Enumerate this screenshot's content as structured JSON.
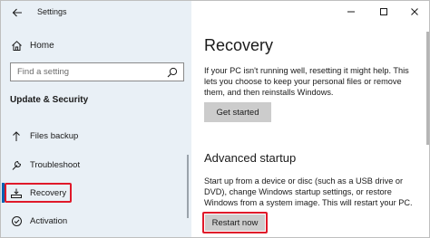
{
  "window": {
    "title": "Settings"
  },
  "sidebar": {
    "home_label": "Home",
    "search_placeholder": "Find a setting",
    "section_title": "Update & Security",
    "items": [
      {
        "label": "Files backup",
        "icon": "upload-arrow-icon",
        "selected": false
      },
      {
        "label": "Troubleshoot",
        "icon": "wrench-icon",
        "selected": false
      },
      {
        "label": "Recovery",
        "icon": "recovery-icon",
        "selected": true
      },
      {
        "label": "Activation",
        "icon": "check-circle-icon",
        "selected": false
      }
    ]
  },
  "content": {
    "title": "Recovery",
    "reset_description": "If your PC isn't running well, resetting it might help. This lets you choose to keep your personal files or remove them, and then reinstalls Windows.",
    "get_started_label": "Get started",
    "advanced_title": "Advanced startup",
    "advanced_description": "Start up from a device or disc (such as a USB drive or DVD), change Windows startup settings, or restore Windows from a system image. This will restart your PC.",
    "restart_label": "Restart now"
  },
  "colors": {
    "sidebar_bg": "#e9f0f6",
    "highlight": "#e0192a",
    "accent": "#0063b1",
    "button_bg": "#cccccc"
  }
}
